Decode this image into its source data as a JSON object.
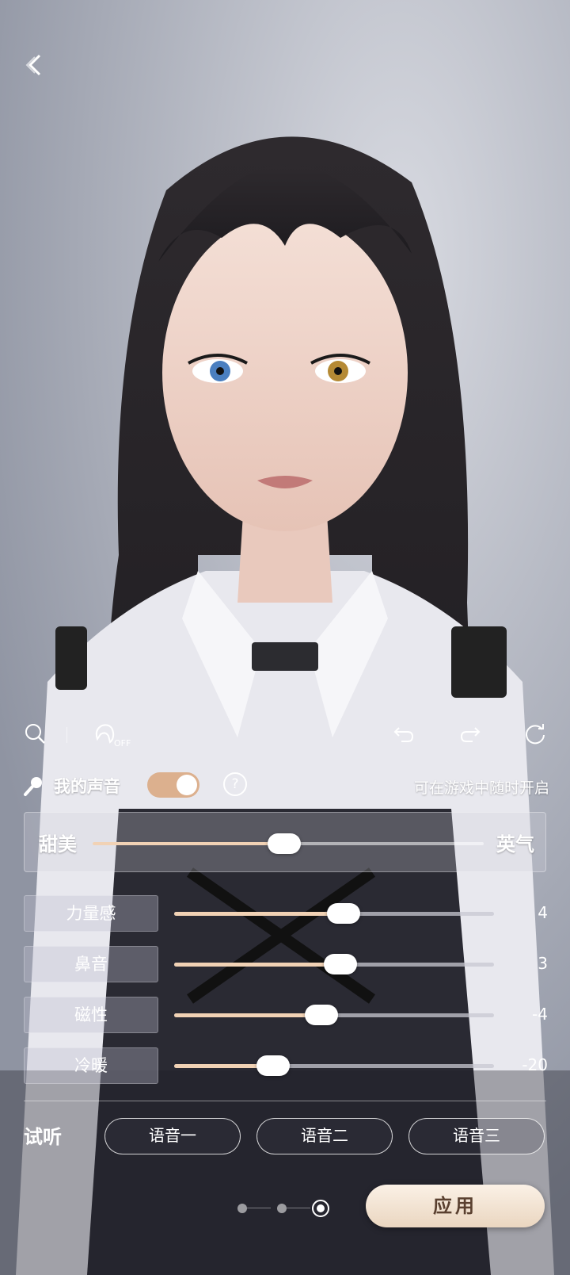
{
  "colors": {
    "accent": "#dcb08e",
    "track_fill": "#f1d2b5",
    "apply_bg": "#f4e6d6",
    "apply_text": "#5a4030"
  },
  "icons": {
    "back": "chevron-left-icon",
    "search": "search-icon",
    "hair_toggle": "hair-off-icon",
    "undo": "undo-icon",
    "redo": "redo-icon",
    "reset": "refresh-icon",
    "mic": "microphone-icon",
    "help": "help-icon"
  },
  "toolbar": {
    "hair_toggle_label": "OFF"
  },
  "voice": {
    "title": "我的声音",
    "enabled": true,
    "help_label": "?",
    "hint": "可在游戏中随时开启"
  },
  "main_slider": {
    "left_label": "甜美",
    "right_label": "英气",
    "level": 0.49
  },
  "params": [
    {
      "label": "力量感",
      "value": "4",
      "level": 0.53
    },
    {
      "label": "鼻音",
      "value": "3",
      "level": 0.52
    },
    {
      "label": "磁性",
      "value": "-4",
      "level": 0.46
    },
    {
      "label": "冷暖",
      "value": "-20",
      "level": 0.31
    }
  ],
  "listen": {
    "label": "试听",
    "options": [
      "语音一",
      "语音二",
      "语音三"
    ]
  },
  "pager": {
    "pages": 3,
    "current": 3
  },
  "apply_label": "应用"
}
